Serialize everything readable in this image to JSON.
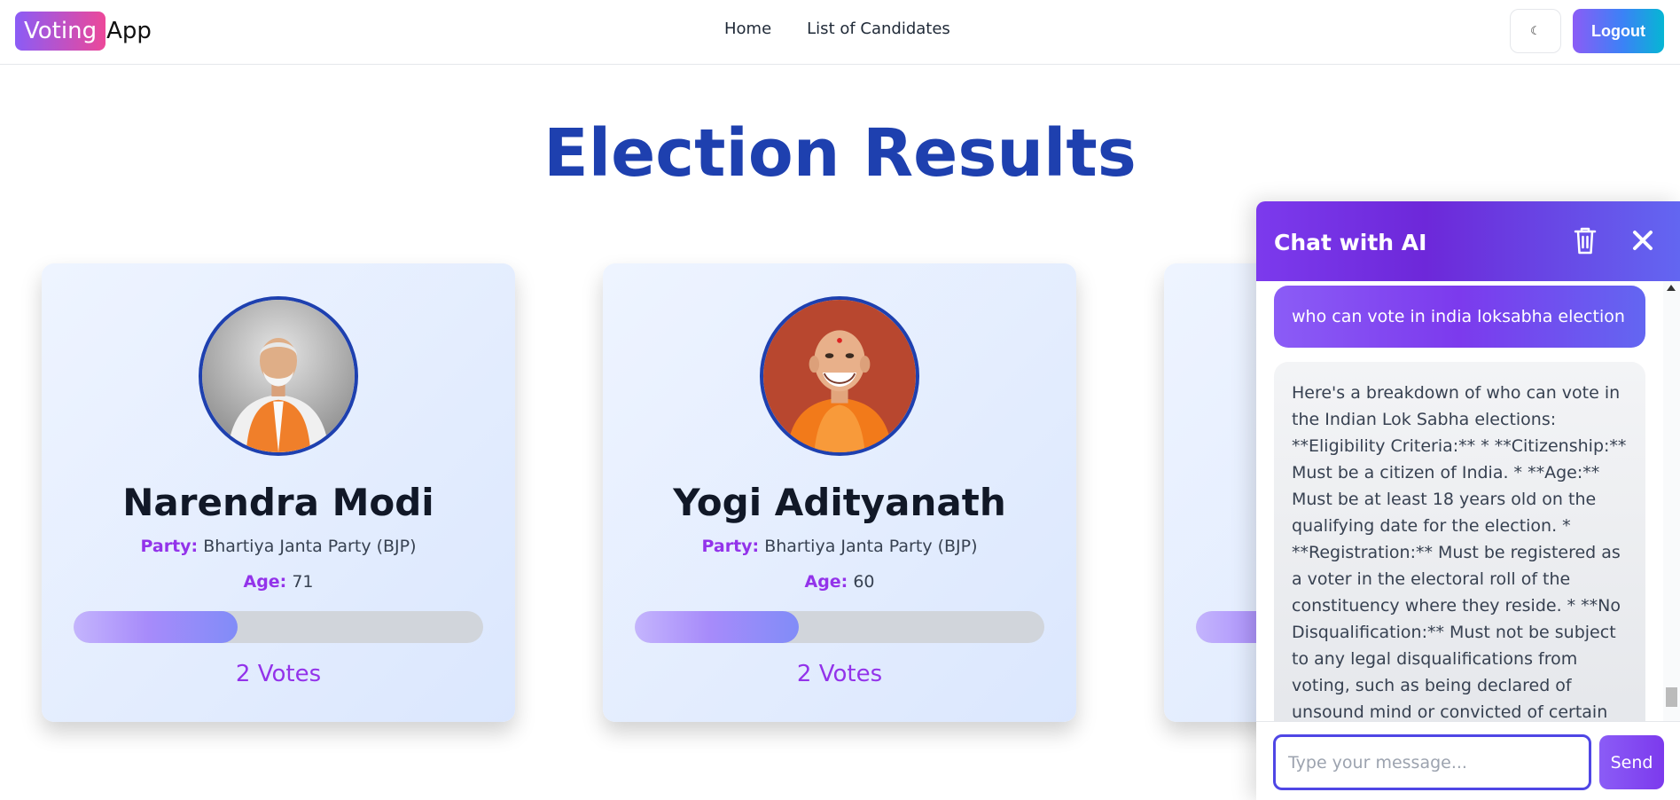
{
  "navbar": {
    "logo_badge": "Voting",
    "logo_rest": "App",
    "links": [
      "Home",
      "List of Candidates"
    ],
    "theme_icon": "moon-icon",
    "theme_glyph": "☾",
    "logout_label": "Logout"
  },
  "page": {
    "title": "Election Results"
  },
  "candidates": [
    {
      "name": "Narendra Modi",
      "party_label": "Party:",
      "party": "Bhartiya Janta Party (BJP)",
      "age_label": "Age:",
      "age": "71",
      "votes_label": "2 Votes",
      "vote_share": 0.4
    },
    {
      "name": "Yogi Adityanath",
      "party_label": "Party:",
      "party": "Bhartiya Janta Party (BJP)",
      "age_label": "Age:",
      "age": "60",
      "votes_label": "2 Votes",
      "vote_share": 0.4
    },
    {
      "vote_share": 0.4
    }
  ],
  "chat": {
    "title": "Chat with AI",
    "trash_icon": "trash-icon",
    "close_icon": "close-icon",
    "user_message": "who can vote in india loksabha election",
    "ai_message": "Here's a breakdown of who can vote in the Indian Lok Sabha elections: **Eligibility Criteria:** * **Citizenship:** Must be a citizen of India. * **Age:** Must be at least 18 years old on the qualifying date for the election. * **Registration:** Must be registered as a voter in the electoral roll of the constituency where they reside. * **No Disqualification:** Must not be subject to any legal disqualifications from voting, such as being declared of unsound mind or convicted of certain offenses. **Who Can't Vote:** * **Non-citizens:**",
    "input_placeholder": "Type your message...",
    "send_label": "Send"
  }
}
